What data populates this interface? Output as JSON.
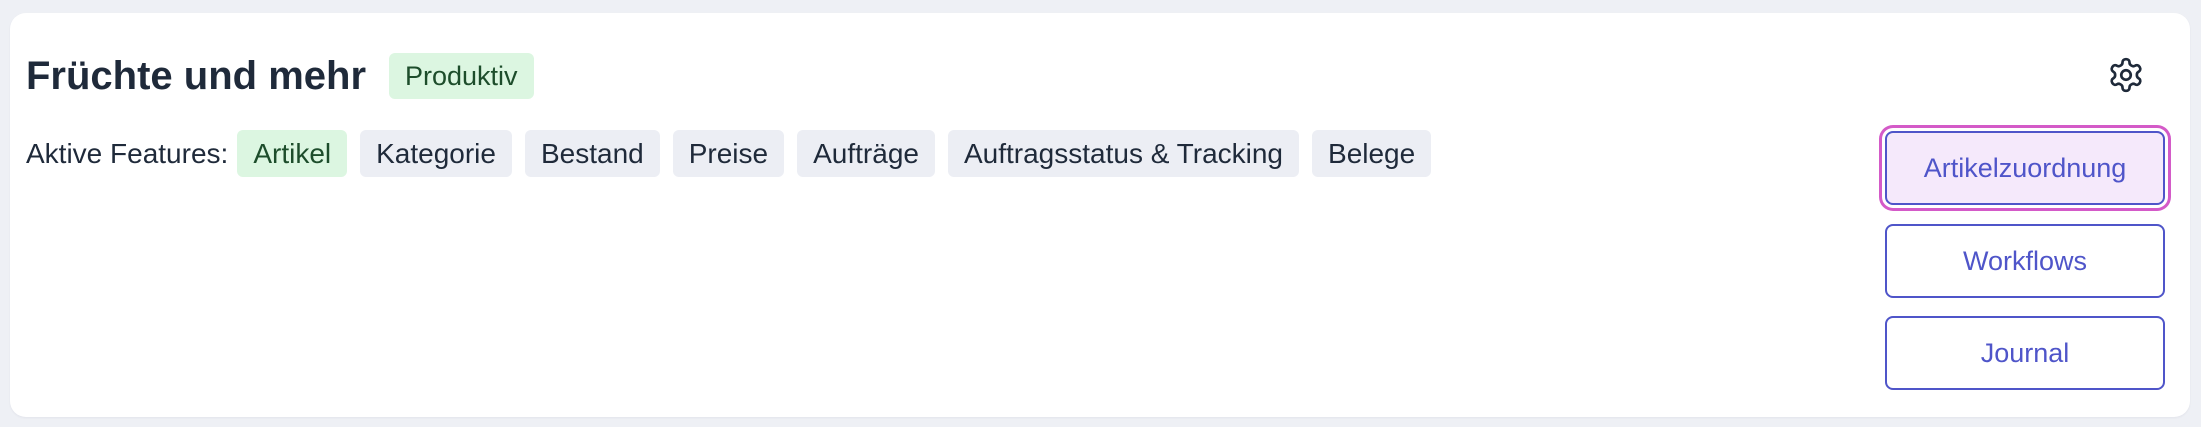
{
  "project": {
    "title": "Früchte und mehr",
    "status": "Produktiv"
  },
  "features": {
    "label": "Aktive Features:",
    "items": [
      {
        "label": "Artikel",
        "active": true
      },
      {
        "label": "Kategorie",
        "active": false
      },
      {
        "label": "Bestand",
        "active": false
      },
      {
        "label": "Preise",
        "active": false
      },
      {
        "label": "Aufträge",
        "active": false
      },
      {
        "label": "Auftragsstatus & Tracking",
        "active": false
      },
      {
        "label": "Belege",
        "active": false
      }
    ]
  },
  "actions": {
    "settings_icon": "gear-icon",
    "buttons": [
      {
        "label": "Artikelzuordnung",
        "selected": true
      },
      {
        "label": "Workflows",
        "selected": false
      },
      {
        "label": "Journal",
        "selected": false
      }
    ]
  },
  "colors": {
    "accent": "#4f55c9",
    "success_bg": "#dcf6e1",
    "focus_ring": "#d45ac8",
    "tag_bg": "#eceef4"
  }
}
